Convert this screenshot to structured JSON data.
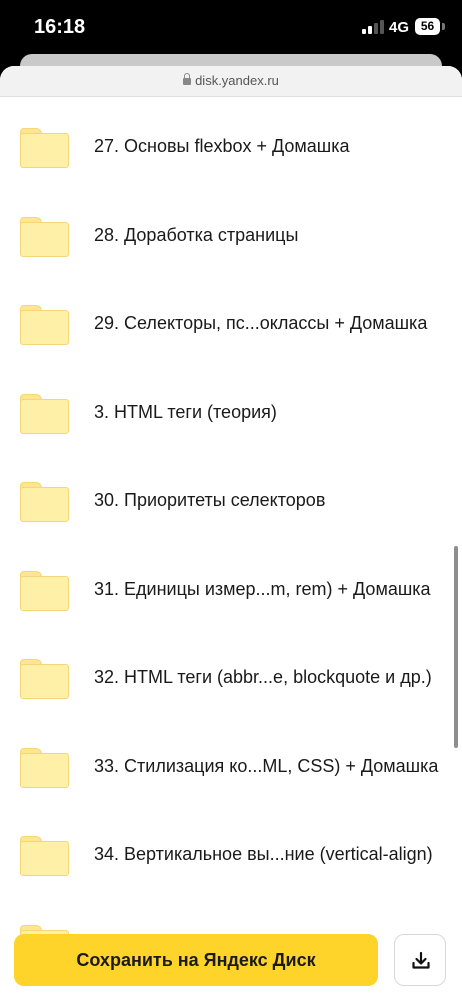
{
  "status_bar": {
    "time": "16:18",
    "network": "4G",
    "battery": "56"
  },
  "browser": {
    "url": "disk.yandex.ru"
  },
  "folders": [
    {
      "label": "27. Основы flexbox + Домашка"
    },
    {
      "label": "28. Доработка страницы"
    },
    {
      "label": "29. Селекторы, пс...оклассы + Домашка"
    },
    {
      "label": "3. HTML теги (теория)"
    },
    {
      "label": "30. Приоритеты селекторов"
    },
    {
      "label": "31. Единицы измер...m, rem) + Домашка"
    },
    {
      "label": "32. HTML теги (abbr...e, blockquote и др.)"
    },
    {
      "label": "33. Стилизация ко...ML, CSS) + Домашка"
    },
    {
      "label": "34. Вертикальное вы...ние (vertical-align)"
    }
  ],
  "actions": {
    "save_label": "Сохранить на Яндекс Диск",
    "download_icon": "download-icon"
  },
  "colors": {
    "accent": "#fed42b",
    "folder": "#fff0a8"
  }
}
